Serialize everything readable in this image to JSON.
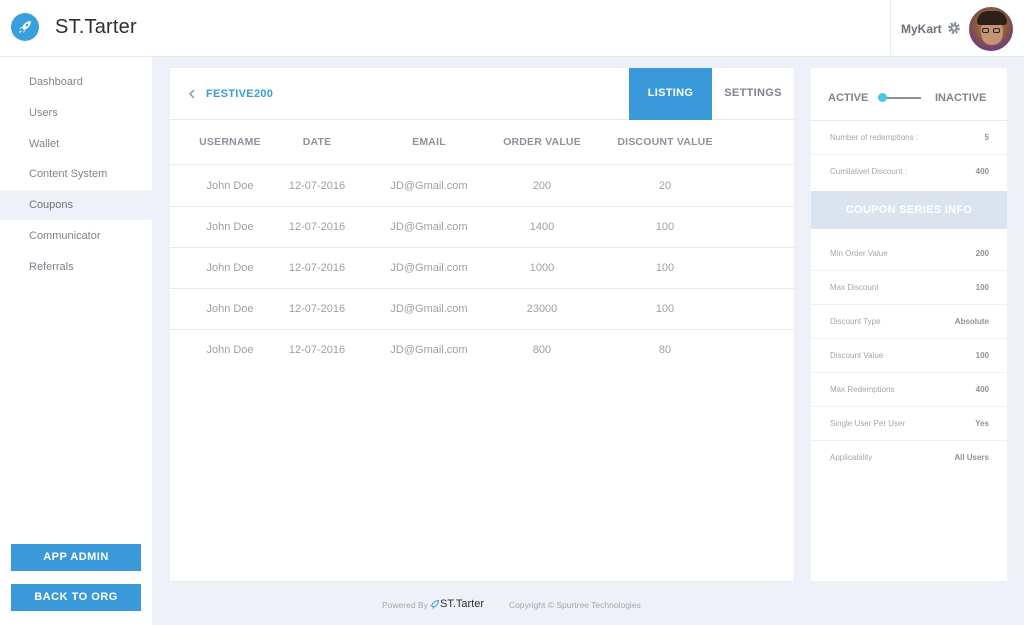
{
  "app": {
    "brand": "ST.Tarter",
    "org_name": "MyKart"
  },
  "sidebar": {
    "items": [
      {
        "label": "Dashboard"
      },
      {
        "label": "Users"
      },
      {
        "label": "Wallet"
      },
      {
        "label": "Content System"
      },
      {
        "label": "Coupons",
        "active": true
      },
      {
        "label": "Communicator"
      },
      {
        "label": "Referrals"
      }
    ],
    "app_admin_label": "APP ADMIN",
    "back_to_org_label": "BACK TO ORG"
  },
  "main": {
    "coupon_code": "FESTIVE200",
    "tabs": [
      {
        "label": "LISTING",
        "active": true
      },
      {
        "label": "SETTINGS"
      }
    ],
    "columns": [
      "USERNAME",
      "DATE",
      "EMAIL",
      "ORDER VALUE",
      "DISCOUNT VALUE"
    ],
    "rows": [
      [
        "John Doe",
        "12-07-2016",
        "JD@Gmail.com",
        "200",
        "20"
      ],
      [
        "John Doe",
        "12-07-2016",
        "JD@Gmail.com",
        "1400",
        "100"
      ],
      [
        "John Doe",
        "12-07-2016",
        "JD@Gmail.com",
        "1000",
        "100"
      ],
      [
        "John Doe",
        "12-07-2016",
        "JD@Gmail.com",
        "23000",
        "100"
      ],
      [
        "John Doe",
        "12-07-2016",
        "JD@Gmail.com",
        "800",
        "80"
      ]
    ]
  },
  "panel": {
    "toggle": {
      "active_label": "ACTIVE",
      "inactive_label": "INACTIVE",
      "state": "active"
    },
    "stats": [
      {
        "label": "Number of redemptions :",
        "value": "5"
      },
      {
        "label": "Cumilativel Discount :",
        "value": "400"
      }
    ],
    "section_title": "COUPON SERIES INFO",
    "info": [
      {
        "label": "Min Order Value",
        "value": "200"
      },
      {
        "label": "Max Discount",
        "value": "100"
      },
      {
        "label": "Discount Type",
        "value": "Absolute"
      },
      {
        "label": "Discount Value",
        "value": "100"
      },
      {
        "label": "Max Redemptions",
        "value": "400"
      },
      {
        "label": "Single User Per User",
        "value": "Yes"
      },
      {
        "label": "Applicability",
        "value": "All Users"
      }
    ]
  },
  "footer": {
    "powered_by": "Powered By",
    "brand": "ST.Tarter",
    "copyright": "Copyright © Spurtree Technologies"
  },
  "colors": {
    "accent": "#3a9ad9",
    "toggle_knob": "#46c6e8",
    "section_bg": "#dbe4ee",
    "page_bg": "#eef2f8"
  },
  "icons": {
    "logo": "rocket-icon",
    "settings": "gear-icon",
    "back": "chevron-left-icon",
    "footer_logo": "rocket-icon"
  }
}
